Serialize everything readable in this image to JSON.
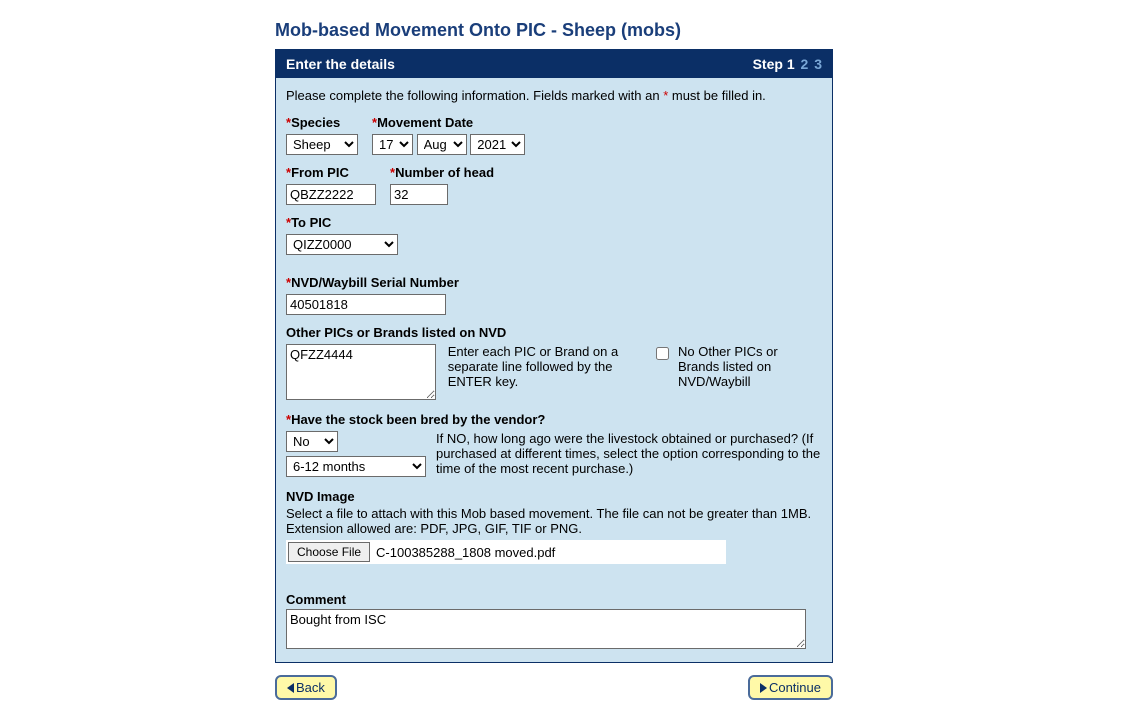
{
  "page_title": "Mob-based Movement Onto PIC - Sheep (mobs)",
  "header": {
    "title": "Enter the details",
    "step_label": "Step",
    "current_step": "1",
    "other_steps": [
      "2",
      "3"
    ]
  },
  "intro": {
    "text_before": "Please complete the following information. Fields marked with an ",
    "asterisk": "*",
    "text_after": " must be filled in."
  },
  "labels": {
    "species": "Species",
    "movement_date": "Movement Date",
    "from_pic": "From PIC",
    "num_head": "Number of head",
    "to_pic": "To PIC",
    "nvd_serial": "NVD/Waybill Serial Number",
    "other_pics": "Other PICs or Brands listed on NVD",
    "other_pics_hint": "Enter each PIC or Brand on a separate line followed by the ENTER key.",
    "no_other_pics": "No Other PICs or Brands listed on NVD/Waybill",
    "bred_by_vendor": "Have the stock been bred by the vendor?",
    "bred_note": "If NO, how long ago were the livestock obtained or purchased? (If purchased at different times, select the option corresponding to the time of the most recent purchase.)",
    "nvd_image": "NVD Image",
    "nvd_image_desc": "Select a file to attach with this Mob based movement. The file can not be greater than 1MB. Extension allowed are: PDF, JPG, GIF, TIF or PNG.",
    "choose_file": "Choose File",
    "comment": "Comment"
  },
  "values": {
    "species": "Sheep",
    "day": "17",
    "month": "Aug",
    "year": "2021",
    "from_pic": "QBZZ2222",
    "num_head": "32",
    "to_pic": "QIZZ0000",
    "nvd_serial": "40501818",
    "other_pics": "QFZZ4444",
    "no_other_checked": false,
    "bred": "No",
    "how_long": "6-12 months",
    "file_name": "C-100385288_1808 moved.pdf",
    "comment": "Bought from ISC"
  },
  "buttons": {
    "back": "Back",
    "continue": "Continue"
  }
}
